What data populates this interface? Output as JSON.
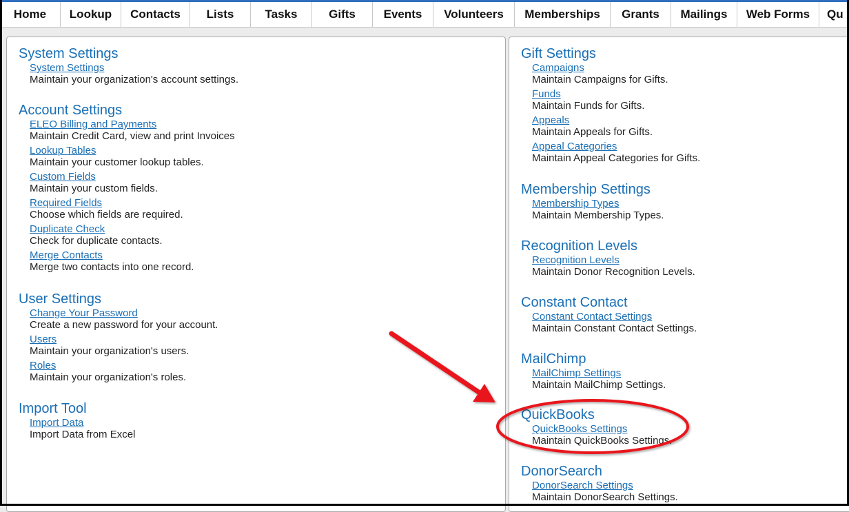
{
  "nav": {
    "items": [
      "Home",
      "Lookup",
      "Contacts",
      "Lists",
      "Tasks",
      "Gifts",
      "Events",
      "Volunteers",
      "Memberships",
      "Grants",
      "Mailings",
      "Web Forms",
      "Qu"
    ]
  },
  "left": {
    "system": {
      "title": "System Settings",
      "items": [
        {
          "link": "System Settings",
          "desc": "Maintain your organization's account settings."
        }
      ]
    },
    "account": {
      "title": "Account Settings",
      "items": [
        {
          "link": "ELEO Billing and Payments",
          "desc": "Maintain Credit Card, view and print Invoices"
        },
        {
          "link": "Lookup Tables",
          "desc": "Maintain your customer lookup tables."
        },
        {
          "link": "Custom Fields",
          "desc": "Maintain your custom fields."
        },
        {
          "link": "Required Fields",
          "desc": "Choose which fields are required."
        },
        {
          "link": "Duplicate Check",
          "desc": "Check for duplicate contacts."
        },
        {
          "link": "Merge Contacts",
          "desc": "Merge two contacts into one record."
        }
      ]
    },
    "user": {
      "title": "User Settings",
      "items": [
        {
          "link": "Change Your Password",
          "desc": "Create a new password for your account."
        },
        {
          "link": "Users",
          "desc": "Maintain your organization's users."
        },
        {
          "link": "Roles",
          "desc": "Maintain your organization's roles."
        }
      ]
    },
    "import": {
      "title": "Import Tool",
      "items": [
        {
          "link": "Import Data",
          "desc": "Import Data from Excel"
        }
      ]
    }
  },
  "right": {
    "gift": {
      "title": "Gift Settings",
      "items": [
        {
          "link": "Campaigns",
          "desc": "Maintain Campaigns for Gifts."
        },
        {
          "link": "Funds",
          "desc": "Maintain Funds for Gifts."
        },
        {
          "link": "Appeals",
          "desc": "Maintain Appeals for Gifts."
        },
        {
          "link": "Appeal Categories",
          "desc": "Maintain Appeal Categories for Gifts."
        }
      ]
    },
    "membership": {
      "title": "Membership Settings",
      "items": [
        {
          "link": "Membership Types",
          "desc": "Maintain Membership Types."
        }
      ]
    },
    "recognition": {
      "title": "Recognition Levels",
      "items": [
        {
          "link": "Recognition Levels",
          "desc": "Maintain Donor Recognition Levels."
        }
      ]
    },
    "constant": {
      "title": "Constant Contact",
      "items": [
        {
          "link": "Constant Contact Settings",
          "desc": "Maintain Constant Contact Settings."
        }
      ]
    },
    "mailchimp": {
      "title": "MailChimp",
      "items": [
        {
          "link": "MailChimp Settings",
          "desc": "Maintain MailChimp Settings."
        }
      ]
    },
    "quickbooks": {
      "title": "QuickBooks",
      "items": [
        {
          "link": "QuickBooks Settings",
          "desc": "Maintain QuickBooks Settings."
        }
      ]
    },
    "donorsearch": {
      "title": "DonorSearch",
      "items": [
        {
          "link": "DonorSearch Settings",
          "desc": "Maintain DonorSearch Settings."
        }
      ]
    }
  },
  "colors": {
    "link": "#1a6fb5",
    "nav_accent": "#2f6fbf",
    "annotation": "#e8151b"
  }
}
